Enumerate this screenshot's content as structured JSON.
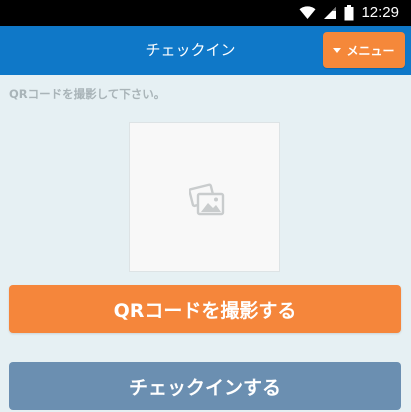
{
  "status_bar": {
    "time": "12:29",
    "icons": [
      "wifi-icon",
      "signal-icon",
      "battery-icon"
    ]
  },
  "header": {
    "title": "チェックイン",
    "menu_label": "メニュー",
    "menu_icon": "caret-down-icon"
  },
  "main": {
    "instruction": "QRコードを撮影して下さい。",
    "preview_icon": "image-placeholder-icon",
    "capture_button_label": "QRコードを撮影する",
    "checkin_button_label": "チェックインする"
  },
  "colors": {
    "header_bg": "#0f78c8",
    "accent_orange": "#f5863b",
    "checkin_button_bg": "#6b8fb1",
    "page_bg": "#e6f0f3"
  }
}
